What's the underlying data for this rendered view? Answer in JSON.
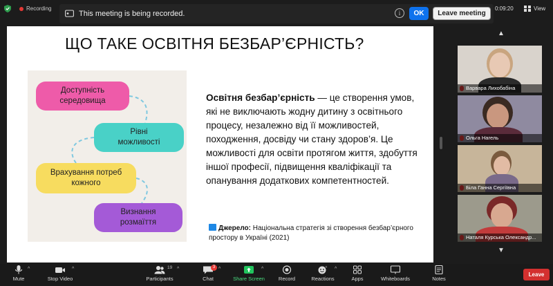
{
  "topbar": {
    "recording_label": "Recording",
    "timer": "0:09:20",
    "view_label": "View"
  },
  "notice": {
    "text": "This meeting is being recorded.",
    "ok_label": "OK",
    "leave_label": "Leave meeting"
  },
  "slide": {
    "title": "ЩО ТАКЕ ОСВІТНЯ БЕЗБАР’ЄРНІСТЬ?",
    "pills": [
      {
        "line1": "Доступність",
        "line2": "середовища"
      },
      {
        "line1": "Рівні",
        "line2": "можливості"
      },
      {
        "line1": "Врахування потреб",
        "line2": "кожного"
      },
      {
        "line1": "Визнання",
        "line2": "розмаїття"
      }
    ],
    "body_bold": "Освітня безбар’єрність",
    "body_rest": " — це створення умов, які не виключають жодну дитину з освітнього процесу, незалежно від її можливостей, походження, досвіду чи стану здоров’я. Це можливості для освіти протягом життя, здобуття іншої професії, підвищення кваліфікації та опанування додаткових компетентностей.",
    "source_label": "Джерело:",
    "source_text": " Національна стратегія зі створення безбар’єрного простору в Україні (2021)"
  },
  "participants": [
    {
      "name": "Варвара Лихобабіна",
      "bg": "#d9d3cc",
      "skin": "#e8c9b4",
      "hair": "#c9a57f",
      "shirt": "#2b2b2b"
    },
    {
      "name": "Ольга Нагель",
      "bg": "#8f8aa0",
      "skin": "#c9977f",
      "hair": "#3a2a22",
      "shirt": "#5a2b3a"
    },
    {
      "name": "Біла Ганна Сергіївна",
      "bg": "#c7b59a",
      "skin": "#e2bba4",
      "hair": "#7a5a3e",
      "shirt": "#7a6a8a"
    },
    {
      "name": "Наталя Курська Олександр...",
      "bg": "#9c9a8c",
      "skin": "#d8a890",
      "hair": "#7a2828",
      "shirt": "#c23b3b"
    }
  ],
  "toolbar": {
    "mute": "Mute",
    "stop_video": "Stop Video",
    "participants": "Participants",
    "participants_count": "19",
    "chat": "Chat",
    "chat_badge": "3",
    "share_screen": "Share Screen",
    "record": "Record",
    "reactions": "Reactions",
    "apps": "Apps",
    "whiteboards": "Whiteboards",
    "notes": "Notes",
    "leave": "Leave"
  },
  "colors": {
    "ok_blue": "#0e72ed",
    "leave_red": "#d3302f",
    "share_green": "#22c55e",
    "pill_pink": "#ee5ba9",
    "pill_teal": "#49d1c7",
    "pill_yellow": "#f7dc5f",
    "pill_purple": "#a45ad7"
  }
}
